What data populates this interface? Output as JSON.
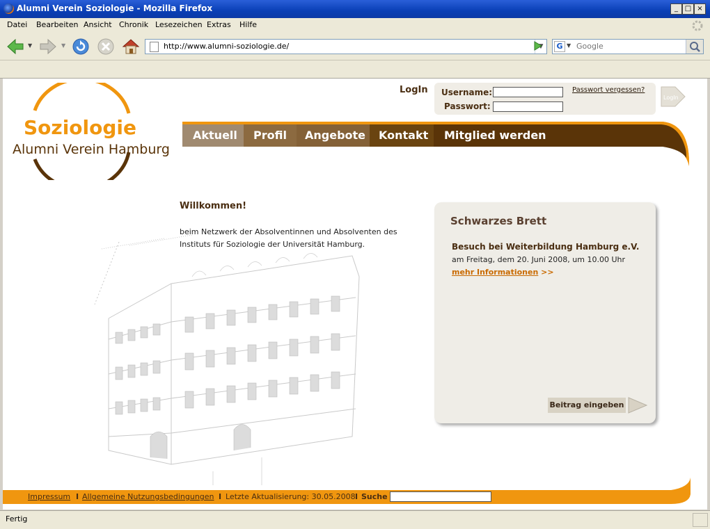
{
  "window": {
    "title": "Alumni Verein Soziologie - Mozilla Firefox",
    "buttons": [
      "_",
      "□",
      "×"
    ]
  },
  "menu": [
    "Datei",
    "Bearbeiten",
    "Ansicht",
    "Chronik",
    "Lesezeichen",
    "Extras",
    "Hilfe"
  ],
  "toolbar": {
    "url": "http://www.alumni-soziologie.de/",
    "search_placeholder": "Google",
    "icons": [
      "back-icon",
      "forward-icon",
      "reload-icon",
      "stop-icon",
      "home-icon",
      "go-icon",
      "search-icon"
    ]
  },
  "status": {
    "text": "Fertig"
  },
  "site": {
    "logo": {
      "line1": "Soziologie",
      "line2": "Alumni Verein Hamburg"
    },
    "login": {
      "title": "LogIn",
      "username_label": "Username:",
      "password_label": "Passwort:",
      "forgot": "Passwort vergessen?",
      "button": "LogIn"
    },
    "nav": [
      "Aktuell",
      "Profil",
      "Angebote",
      "Kontakt",
      "Mitglied werden"
    ],
    "welcome": {
      "title": "Willkommen!",
      "text": "beim Netzwerk der Absolventinnen und Absolventen des Instituts für Soziologie der Universität Hamburg."
    },
    "board": {
      "title": "Schwarzes Brett",
      "item_title": "Besuch bei Weiterbildung Hamburg e.V.",
      "item_text": "am Freitag, dem 20. Juni 2008, um 10.00 Uhr",
      "item_link": "mehr Informationen",
      "item_link_suffix": ">>",
      "post_button": "Beitrag eingeben"
    },
    "footer": {
      "impressum": "Impressum",
      "terms": "Allgemeine Nutzungsbedingungen",
      "updated": "Letzte Aktualisierung: 30.05.2008",
      "search_label": "Suche",
      "separator": "I"
    },
    "colors": {
      "orange": "#f0960f",
      "brown": "#5a3409",
      "tab_tan": "#a08a70",
      "tab_mid": "#8c6a40",
      "tab_dark": "#6a4410",
      "tab_darkest": "#5a3408"
    }
  }
}
